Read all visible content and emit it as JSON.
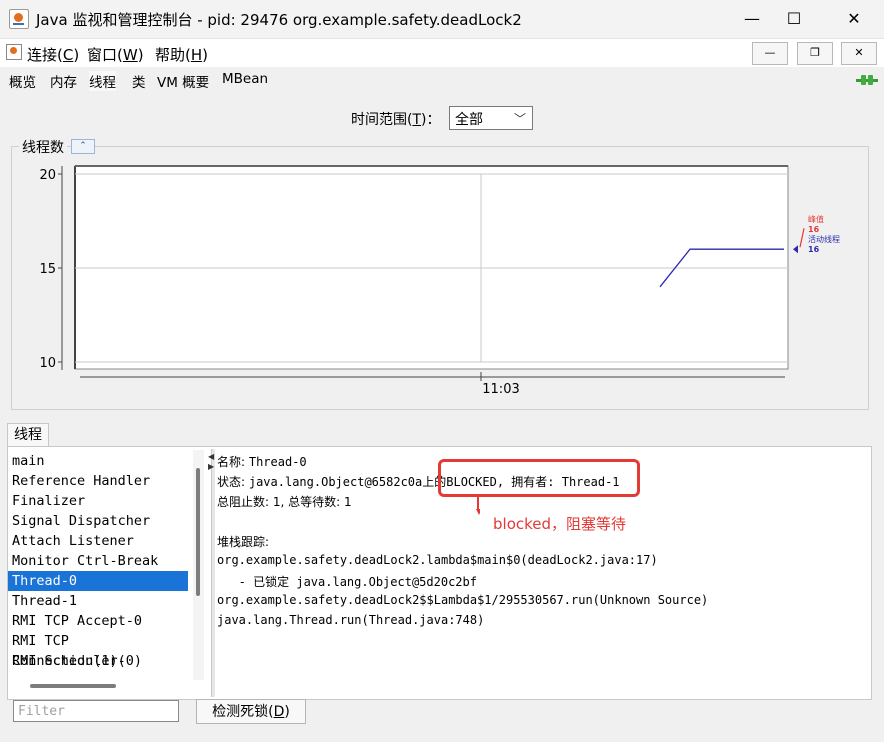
{
  "window": {
    "title": "Java 监视和管理控制台 - pid: 29476 org.example.safety.deadLock2",
    "minimize_glyph": "—",
    "maximize_glyph": "☐",
    "close_glyph": "✕"
  },
  "menubar": {
    "items": [
      {
        "text": "连接(",
        "key": "C",
        "end": ")"
      },
      {
        "text": "窗口(",
        "key": "W",
        "end": ")"
      },
      {
        "text": "帮助(",
        "key": "H",
        "end": ")"
      }
    ],
    "mdi_minimize": "—",
    "mdi_restore": "❐",
    "mdi_close": "✕"
  },
  "tabs": [
    "概览",
    "内存",
    "线程",
    "类",
    "VM 概要",
    "MBean"
  ],
  "active_tab": "线程",
  "time_range": {
    "label_pre": "时间范围(",
    "label_key": "T",
    "label_post": ")：",
    "selected": "全部",
    "chevron": "﹀"
  },
  "chart_panel": {
    "title": "线程数",
    "collapse_glyph": "⌃"
  },
  "chart_data": {
    "type": "line",
    "title": "",
    "ylim": [
      10,
      20
    ],
    "yticks": [
      "20",
      "15",
      "10"
    ],
    "xticks": [
      "11:03"
    ],
    "series": [
      {
        "name": "峰值",
        "current": "16",
        "color": "#e53935",
        "values": []
      },
      {
        "name": "活动线程",
        "current": "16",
        "color": "#2b2bb0",
        "values": [
          14,
          16,
          16
        ]
      }
    ]
  },
  "threads_panel": {
    "tab_label": "线程",
    "list": [
      "main",
      "Reference Handler",
      "Finalizer",
      "Signal Dispatcher",
      "Attach Listener",
      "Monitor Ctrl-Break",
      "Thread-0",
      "Thread-1",
      "RMI TCP Accept-0",
      "RMI TCP Connection(1)-",
      "RMI Scheduler(0)"
    ],
    "selected": "Thread-0",
    "details": {
      "name_label": "名称: ",
      "name_value": "Thread-0",
      "state_label": "状态: ",
      "state_value": "java.lang.Object@6582c0a上的BLOCKED, 拥有者: Thread-1",
      "counts": "总阻止数: 1, 总等待数: 1",
      "stack_label": "堆栈跟踪:",
      "stack": [
        "org.example.safety.deadLock2.lambda$main$0(deadLock2.java:17)",
        "   - 已锁定 java.lang.Object@5d20c2bf",
        "org.example.safety.deadLock2$$Lambda$1/295530567.run(Unknown Source)",
        "java.lang.Thread.run(Thread.java:748)"
      ]
    },
    "annotation": "blocked，阻塞等待",
    "filter_placeholder": "Filter",
    "detect_button": {
      "pre": "检测死锁(",
      "key": "D",
      "post": ")"
    }
  }
}
